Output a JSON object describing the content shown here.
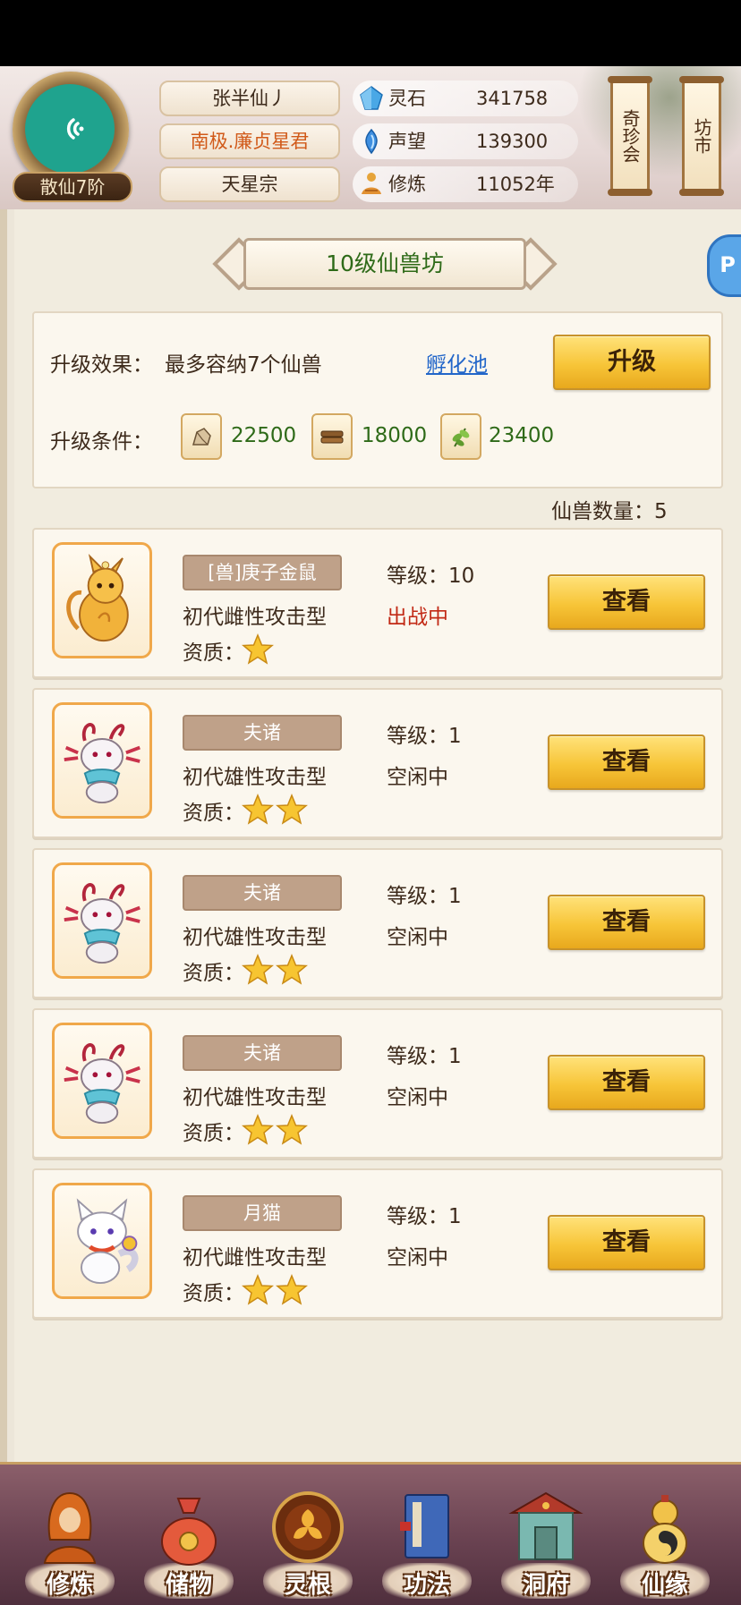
{
  "header": {
    "rank": "散仙7阶",
    "player_name": "张半仙丿",
    "title": "南极.廉贞星君",
    "sect": "天星宗",
    "resources": [
      {
        "icon": "spirit-stone-icon",
        "label": "灵石",
        "value": "341758"
      },
      {
        "icon": "reputation-icon",
        "label": "声望",
        "value": "139300"
      },
      {
        "icon": "cultivation-icon",
        "label": "修炼",
        "value": "11052年"
      }
    ],
    "shop_rare": "奇珍会",
    "shop_market": "坊市"
  },
  "panel": {
    "title": "10级仙兽坊",
    "side_icon": "P",
    "upgrade_effect_label": "升级效果：",
    "upgrade_effect_value": "最多容纳7个仙兽",
    "hatch_link": "孵化池",
    "upgrade_button": "升级",
    "upgrade_cond_label": "升级条件：",
    "materials": [
      {
        "icon": "ore-icon",
        "value": "22500"
      },
      {
        "icon": "wood-icon",
        "value": "18000"
      },
      {
        "icon": "herb-icon",
        "value": "23400"
      }
    ],
    "beast_count_label": "仙兽数量：5"
  },
  "beasts": [
    {
      "name": "[兽]庚子金鼠",
      "type": "初代雌性攻击型",
      "level": "等级：10",
      "status": "出战中",
      "busy": true,
      "stars": 1,
      "quality_label": "资质：",
      "view": "查看",
      "portrait": "golden-rat"
    },
    {
      "name": "夫诸",
      "type": "初代雄性攻击型",
      "level": "等级：1",
      "status": "空闲中",
      "busy": false,
      "stars": 2,
      "quality_label": "资质：",
      "view": "查看",
      "portrait": "fuzhu"
    },
    {
      "name": "夫诸",
      "type": "初代雄性攻击型",
      "level": "等级：1",
      "status": "空闲中",
      "busy": false,
      "stars": 2,
      "quality_label": "资质：",
      "view": "查看",
      "portrait": "fuzhu"
    },
    {
      "name": "夫诸",
      "type": "初代雄性攻击型",
      "level": "等级：1",
      "status": "空闲中",
      "busy": false,
      "stars": 2,
      "quality_label": "资质：",
      "view": "查看",
      "portrait": "fuzhu"
    },
    {
      "name": "月猫",
      "type": "初代雌性攻击型",
      "level": "等级：1",
      "status": "空闲中",
      "busy": false,
      "stars": 2,
      "quality_label": "资质：",
      "view": "查看",
      "portrait": "moon-cat"
    }
  ],
  "nav": [
    {
      "label": "修炼",
      "icon": "monk-icon"
    },
    {
      "label": "储物",
      "icon": "bag-icon"
    },
    {
      "label": "灵根",
      "icon": "spirit-root-icon"
    },
    {
      "label": "功法",
      "icon": "book-icon"
    },
    {
      "label": "洞府",
      "icon": "cave-house-icon"
    },
    {
      "label": "仙缘",
      "icon": "gourd-icon"
    }
  ],
  "colors": {
    "accent_gold": "#f7c538",
    "title_green": "#2e6a18",
    "busy_red": "#c22a16",
    "link_blue": "#2266c9"
  }
}
